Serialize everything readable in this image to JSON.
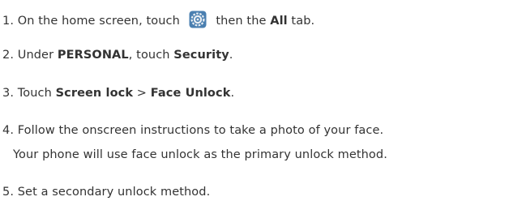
{
  "steps": [
    {
      "num": "1. ",
      "t1": "On the home screen, touch ",
      "icon": "settings-icon",
      "t2": " then the ",
      "b1": "All",
      "t3": " tab."
    },
    {
      "num": "2. ",
      "t1": "Under ",
      "b1": "PERSONAL",
      "t2": ", touch ",
      "b2": "Security",
      "t3": "."
    },
    {
      "num": "3. ",
      "t1": "Touch ",
      "b1": "Screen lock",
      "t2": " > ",
      "b2": "Face Unlock",
      "t3": "."
    },
    {
      "num": "4. ",
      "t1": "Follow the onscreen instructions to take a photo of your face.",
      "note": "Your phone will use face unlock as the primary unlock method."
    },
    {
      "num": "5. ",
      "t1": "Set a secondary unlock method."
    }
  ],
  "colors": {
    "text": "#333333",
    "icon_bg": "#4a7fb0",
    "icon_ring": "#e9eef3"
  }
}
